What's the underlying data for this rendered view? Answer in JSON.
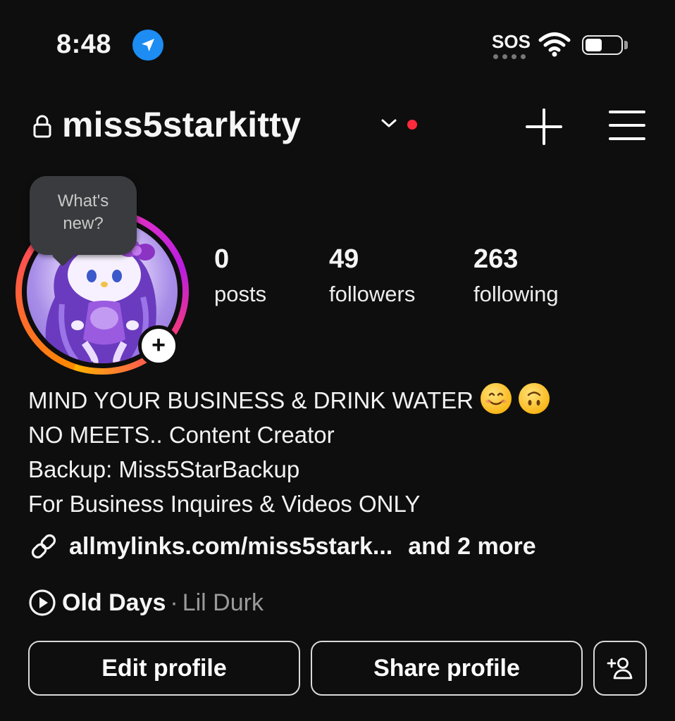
{
  "status_bar": {
    "time": "8:48",
    "location_icon": "location-arrow-icon",
    "carrier_text": "SOS",
    "wifi_icon": "wifi-icon",
    "battery_icon": "battery-icon",
    "battery_level": 0.5
  },
  "header": {
    "lock_icon": "lock-icon",
    "username": "miss5starkitty",
    "chevron_icon": "chevron-down-icon",
    "notification_dot_color": "#ff2a3b",
    "create_icon": "plus-icon",
    "menu_icon": "hamburger-menu-icon"
  },
  "avatar": {
    "note_bubble": {
      "line1": "What's",
      "line2": "new?"
    },
    "add_story_icon": "plus-icon",
    "ring_colors": [
      "#ff8a00",
      "#ff3d6b",
      "#d62bd1"
    ]
  },
  "stats": [
    {
      "value": "0",
      "label": "posts"
    },
    {
      "value": "49",
      "label": "followers"
    },
    {
      "value": "263",
      "label": "following"
    }
  ],
  "bio": {
    "line1": "MIND YOUR BUSINESS & DRINK WATER",
    "line1_emojis": [
      "smiling-face-emoji",
      "upside-down-face-emoji"
    ],
    "line2": "NO MEETS.. Content Creator",
    "line3": "Backup: Miss5StarBackup",
    "line4": "For Business Inquires & Videos ONLY"
  },
  "links": {
    "link_icon": "link-icon",
    "url": "allmylinks.com/miss5stark...",
    "more": "and 2 more"
  },
  "music": {
    "play_icon": "play-circle-icon",
    "title": "Old Days",
    "separator": "·",
    "artist": "Lil Durk"
  },
  "actions": {
    "edit_label": "Edit profile",
    "share_label": "Share profile",
    "discover_icon": "add-person-icon"
  },
  "colors": {
    "background": "#0e0e0e",
    "text": "#f5f5f5",
    "muted": "#9a9a9a",
    "accent_blue": "#1d8cf3"
  }
}
